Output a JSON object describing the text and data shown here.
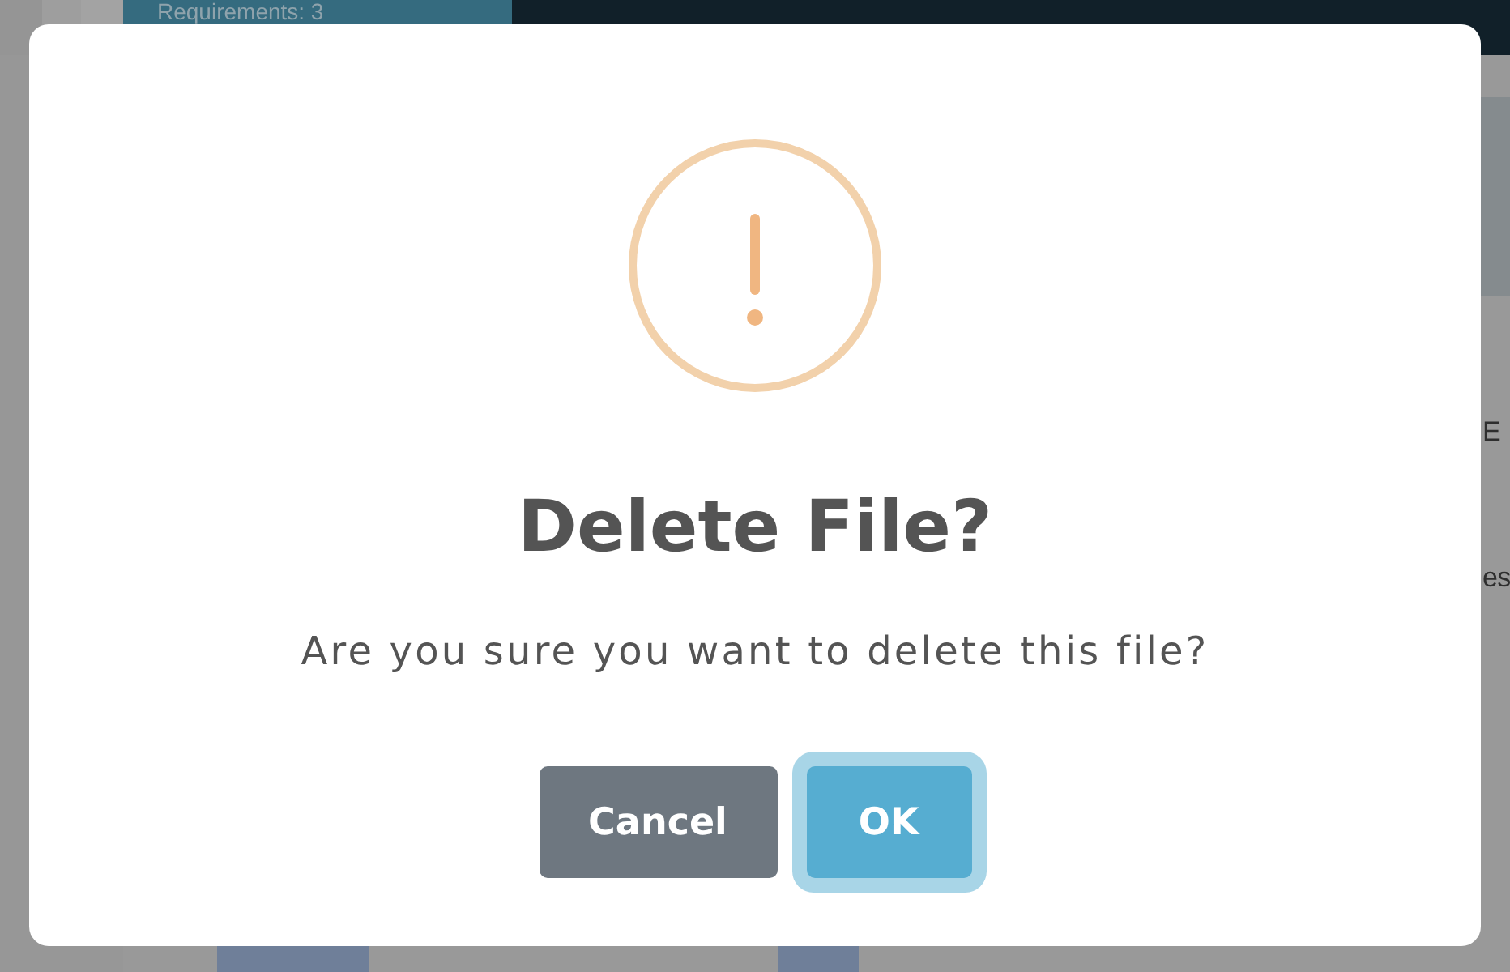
{
  "backdrop": {
    "tab": {
      "label": "Requirements: 3"
    },
    "side_texts": [
      "E",
      "es"
    ]
  },
  "dialog": {
    "title": "Delete File?",
    "message": "Are you sure you want to delete this file?",
    "buttons": [
      {
        "label": "Cancel",
        "kind": "secondary",
        "focused": false
      },
      {
        "label": "OK",
        "kind": "primary",
        "focused": true
      }
    ]
  }
}
